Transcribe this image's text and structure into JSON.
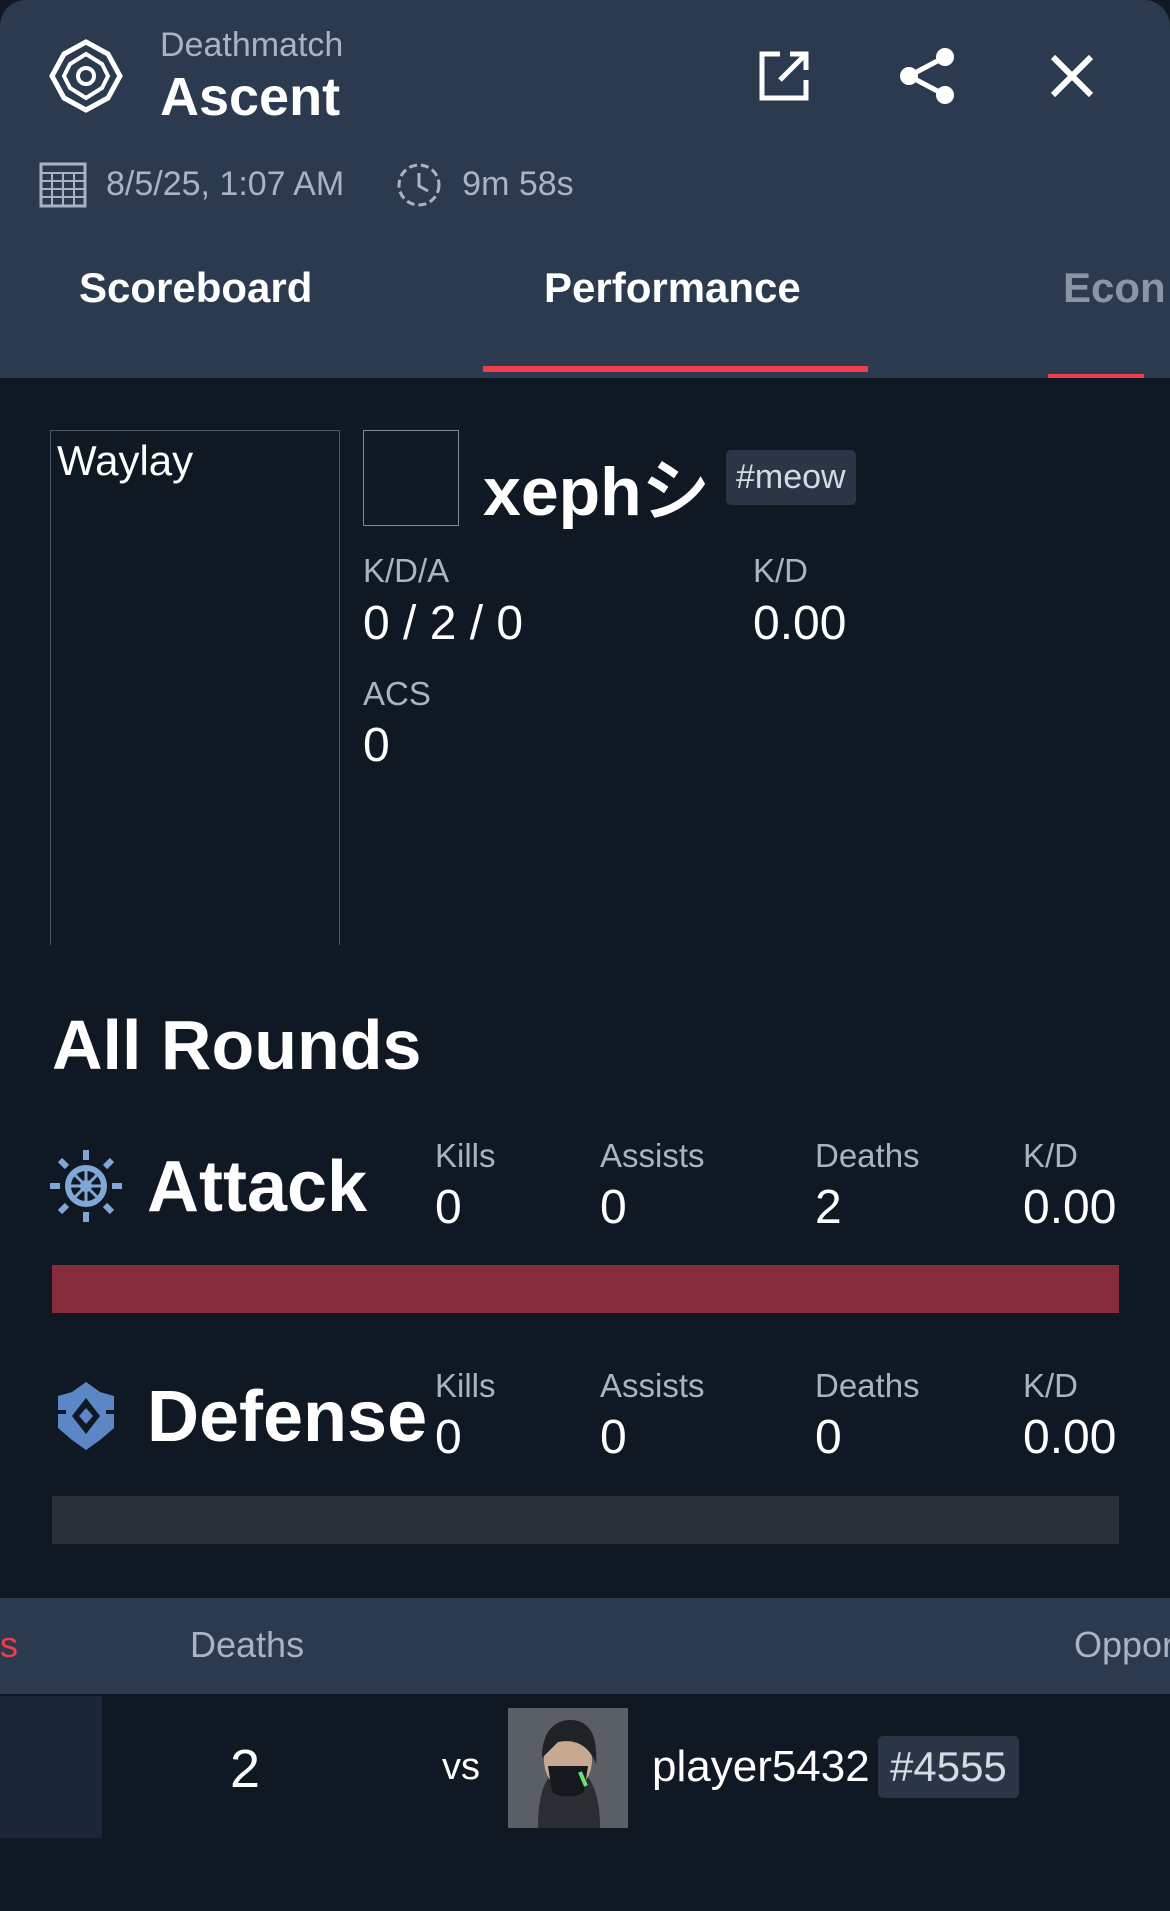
{
  "header": {
    "mode": "Deathmatch",
    "map": "Ascent",
    "date": "8/5/25, 1:07 AM",
    "duration": "9m 58s",
    "icons": [
      "game-logo-icon",
      "open-external-icon",
      "share-icon",
      "close-icon",
      "calendar-icon",
      "clock-icon"
    ]
  },
  "tabs": [
    {
      "label": "Scoreboard",
      "active": false
    },
    {
      "label": "Performance",
      "active": true
    },
    {
      "label": "Econ",
      "active": false
    }
  ],
  "player": {
    "agent": "Waylay",
    "name": "xephシ",
    "tag": "#meow",
    "stats": {
      "kda_label": "K/D/A",
      "kda_value": "0 / 2 / 0",
      "kd_label": "K/D",
      "kd_value": "0.00",
      "acs_label": "ACS",
      "acs_value": "0"
    }
  },
  "all_rounds": {
    "title": "All Rounds",
    "attack": {
      "title": "Attack",
      "kills_label": "Kills",
      "kills": "0",
      "assists_label": "Assists",
      "assists": "0",
      "deaths_label": "Deaths",
      "deaths": "2",
      "kd_label": "K/D",
      "kd": "0.00",
      "bar_color": "#862c3a"
    },
    "defense": {
      "title": "Defense",
      "kills_label": "Kills",
      "kills": "0",
      "assists_label": "Assists",
      "assists": "0",
      "deaths_label": "Deaths",
      "deaths": "0",
      "kd_label": "K/D",
      "kd": "0.00",
      "bar_color": "#2a3039"
    }
  },
  "duel_table": {
    "headers": [
      "s",
      "Deaths",
      "Oppor"
    ],
    "rows": [
      {
        "deaths": "2",
        "vs": "vs",
        "opponent_name": "player5432",
        "opponent_tag": "#4555"
      }
    ]
  },
  "colors": {
    "accent": "#ef3e4a",
    "header_bg": "#2b3a4e",
    "page_bg": "#101823",
    "attack_icon": "#7fa8d6",
    "defense_icon": "#5b87c7"
  }
}
